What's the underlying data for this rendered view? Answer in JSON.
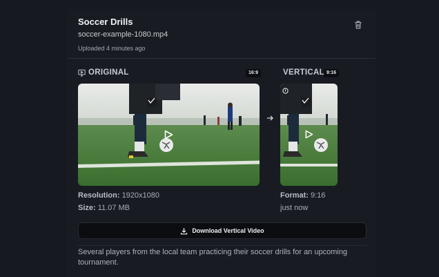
{
  "header": {
    "title": "Soccer Drills",
    "filename": "soccer-example-1080.mp4",
    "uploaded": "Uploaded 4 minutes ago",
    "delete_icon": "trash-icon"
  },
  "original": {
    "label": "ORIGINAL",
    "icon": "screen-icon",
    "ratio": "16:9",
    "resolution_key": "Resolution:",
    "resolution_value": "1920x1080",
    "size_key": "Size:",
    "size_value": "11.07 MB"
  },
  "vertical": {
    "label": "VERTICAL",
    "ratio": "9:16",
    "format_key": "Format:",
    "format_value": "9:16",
    "time": "just now"
  },
  "actions": {
    "download_label": "Download Vertical Video",
    "download_icon": "download-icon"
  },
  "description": "Several players from the local team practicing their soccer drills for an upcoming tournament.",
  "colors": {
    "background": "#161a20",
    "card": "#181c22",
    "button": "#0b0d10",
    "grass": "#3f7a33"
  }
}
